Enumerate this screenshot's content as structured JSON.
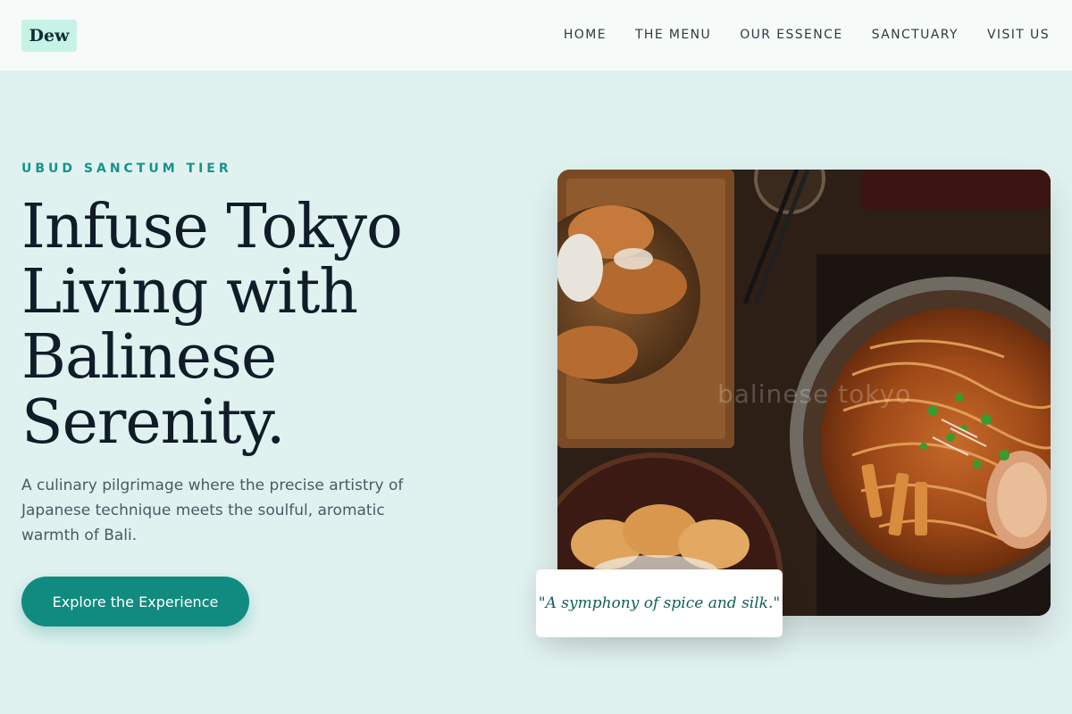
{
  "header": {
    "logo": "Dew",
    "nav": [
      "HOME",
      "THE MENU",
      "OUR ESSENCE",
      "SANCTUARY",
      "VISIT US"
    ]
  },
  "hero": {
    "eyebrow": "UBUD SANCTUM TIER",
    "title_lines": [
      "Infuse Tokyo",
      "Living with",
      "Balinese",
      "Serenity."
    ],
    "description": "A culinary pilgrimage where the precise artistry of Japanese technique meets the soulful, aromatic warmth of Bali.",
    "cta_label": "Explore the Experience",
    "image_watermark": "balinese tokyo",
    "quote": "\"A symphony of spice and silk.\""
  },
  "colors": {
    "background": "#e0f2f0",
    "accent": "#118b80",
    "eyebrow": "#15938a",
    "title": "#101c28",
    "logo_bg": "#c6f3e6"
  }
}
